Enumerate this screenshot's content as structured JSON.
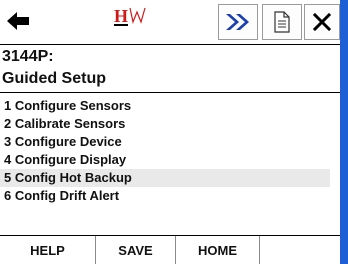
{
  "toolbar": {
    "logo_text": "HW",
    "back_icon": "arrow-left-icon",
    "forward_icon": "double-chevron-right-icon",
    "doc_icon": "document-icon",
    "close_icon": "close-icon"
  },
  "header": {
    "device_tag": "3144P:",
    "title": "Guided Setup"
  },
  "menu": {
    "items": [
      "1 Configure Sensors",
      "2 Calibrate Sensors",
      "3 Configure Device",
      "4 Configure Display",
      "5 Config Hot Backup",
      "6 Config Drift Alert"
    ]
  },
  "softkeys": {
    "help": "HELP",
    "save": "SAVE",
    "home": "HOME"
  },
  "colors": {
    "frame": "#1f5fd6",
    "logo_red": "#d11a1a",
    "forward_blue": "#1a3fb0",
    "highlight": "#e9e9e9"
  }
}
